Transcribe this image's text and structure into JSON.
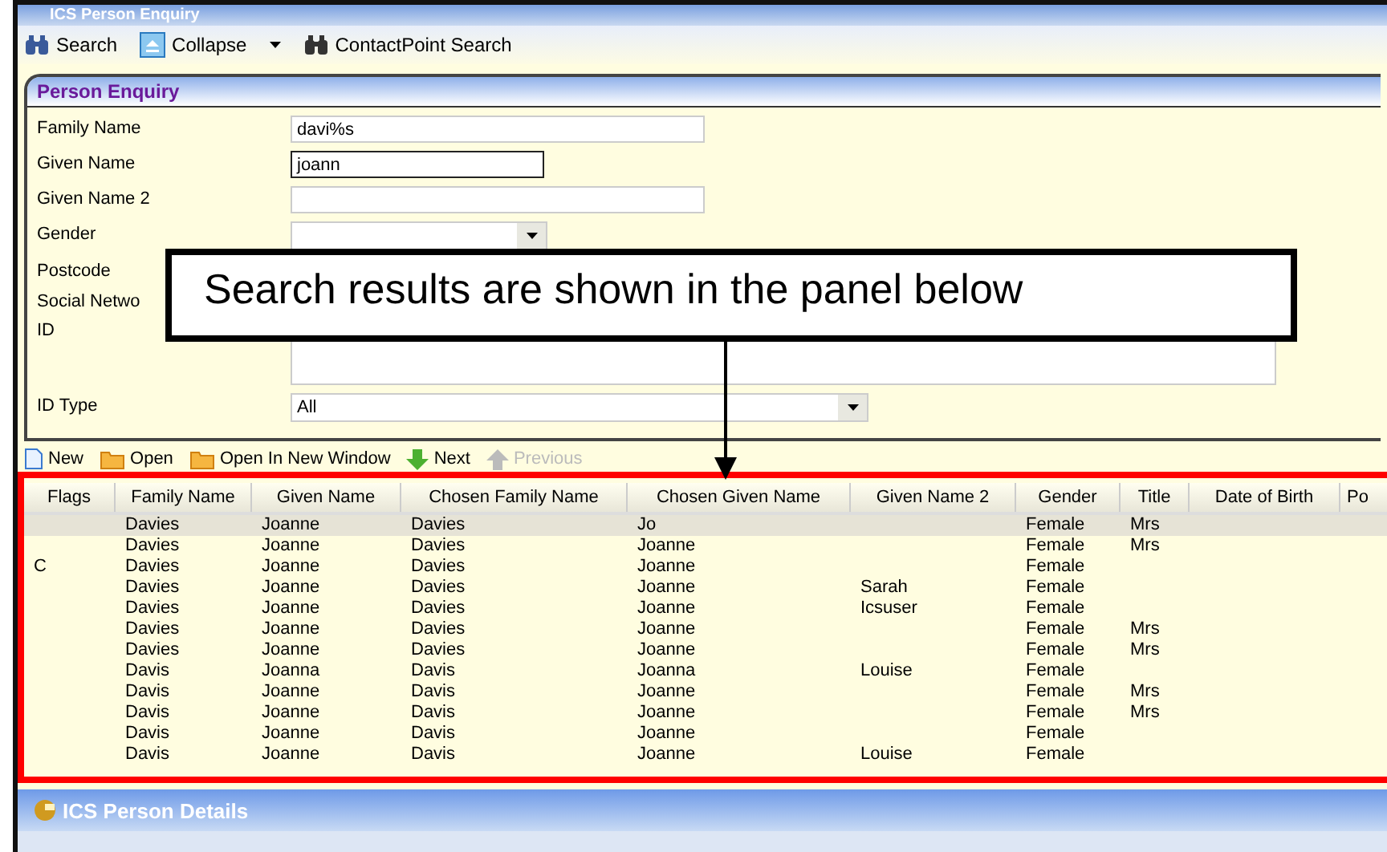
{
  "window": {
    "title": "ICS Person Enquiry"
  },
  "toolbar": [
    {
      "label": "Search",
      "kind": "search"
    },
    {
      "label": "Collapse",
      "kind": "collapse"
    },
    {
      "label": "ContactPoint Search",
      "kind": "binoculars"
    }
  ],
  "panel": {
    "title": "Person Enquiry",
    "fields": [
      {
        "label": "Family Name",
        "kind": "text",
        "value": "davi%s",
        "focused": false
      },
      {
        "label": "Given Name",
        "kind": "text",
        "value": "joann",
        "focused": true
      },
      {
        "label": "Given Name 2",
        "kind": "text",
        "focused": false
      },
      {
        "label": "Gender",
        "kind": "select"
      },
      {
        "label": "Postcode",
        "kind": "label"
      },
      {
        "label": "Social Netwo",
        "label2": "ID",
        "kind": "area"
      },
      {
        "label": "ID Type",
        "kind": "select",
        "value": "All"
      }
    ]
  },
  "actions": [
    {
      "label": "New",
      "kind": "new",
      "disabled": false
    },
    {
      "label": "Open",
      "kind": "folder",
      "disabled": false
    },
    {
      "label": "Open In New Window",
      "kind": "folder",
      "disabled": false
    },
    {
      "label": "Next",
      "kind": "down",
      "disabled": false
    },
    {
      "label": "Previous",
      "kind": "up",
      "disabled": true
    }
  ],
  "table": {
    "columns": [
      "Flags",
      "Family Name",
      "Given Name",
      "Chosen Family Name",
      "Chosen Given Name",
      "Given Name 2",
      "Gender",
      "Title",
      "Date of Birth",
      "Po"
    ],
    "rows": [
      {
        "selected": true,
        "cells": [
          "",
          "Davies",
          "Joanne",
          "Davies",
          "Jo",
          "",
          "Female",
          "Mrs",
          "",
          ""
        ]
      },
      {
        "selected": false,
        "cells": [
          "",
          "Davies",
          "Joanne",
          "Davies",
          "Joanne",
          "",
          "Female",
          "Mrs",
          "",
          ""
        ]
      },
      {
        "selected": false,
        "cells": [
          "C",
          "Davies",
          "Joanne",
          "Davies",
          "Joanne",
          "",
          "Female",
          "",
          "",
          ""
        ]
      },
      {
        "selected": false,
        "cells": [
          "",
          "Davies",
          "Joanne",
          "Davies",
          "Joanne",
          "Sarah",
          "Female",
          "",
          "",
          ""
        ]
      },
      {
        "selected": false,
        "cells": [
          "",
          "Davies",
          "Joanne",
          "Davies",
          "Joanne",
          "Icsuser",
          "Female",
          "",
          "",
          ""
        ]
      },
      {
        "selected": false,
        "cells": [
          "",
          "Davies",
          "Joanne",
          "Davies",
          "Joanne",
          "",
          "Female",
          "Mrs",
          "",
          ""
        ]
      },
      {
        "selected": false,
        "cells": [
          "",
          "Davies",
          "Joanne",
          "Davies",
          "Joanne",
          "",
          "Female",
          "Mrs",
          "",
          ""
        ]
      },
      {
        "selected": false,
        "cells": [
          "",
          "Davis",
          "Joanna",
          "Davis",
          "Joanna",
          "Louise",
          "Female",
          "",
          "",
          ""
        ]
      },
      {
        "selected": false,
        "cells": [
          "",
          "Davis",
          "Joanne",
          "Davis",
          "Joanne",
          "",
          "Female",
          "Mrs",
          "",
          ""
        ]
      },
      {
        "selected": false,
        "cells": [
          "",
          "Davis",
          "Joanne",
          "Davis",
          "Joanne",
          "",
          "Female",
          "Mrs",
          "",
          ""
        ]
      },
      {
        "selected": false,
        "cells": [
          "",
          "Davis",
          "Joanne",
          "Davis",
          "Joanne",
          "",
          "Female",
          "",
          "",
          ""
        ]
      },
      {
        "selected": false,
        "cells": [
          "",
          "Davis",
          "Joanne",
          "Davis",
          "Joanne",
          "Louise",
          "Female",
          "",
          "",
          ""
        ]
      }
    ]
  },
  "details": {
    "title": "ICS Person Details"
  },
  "callout": {
    "text": "Search results are shown in the panel below"
  }
}
